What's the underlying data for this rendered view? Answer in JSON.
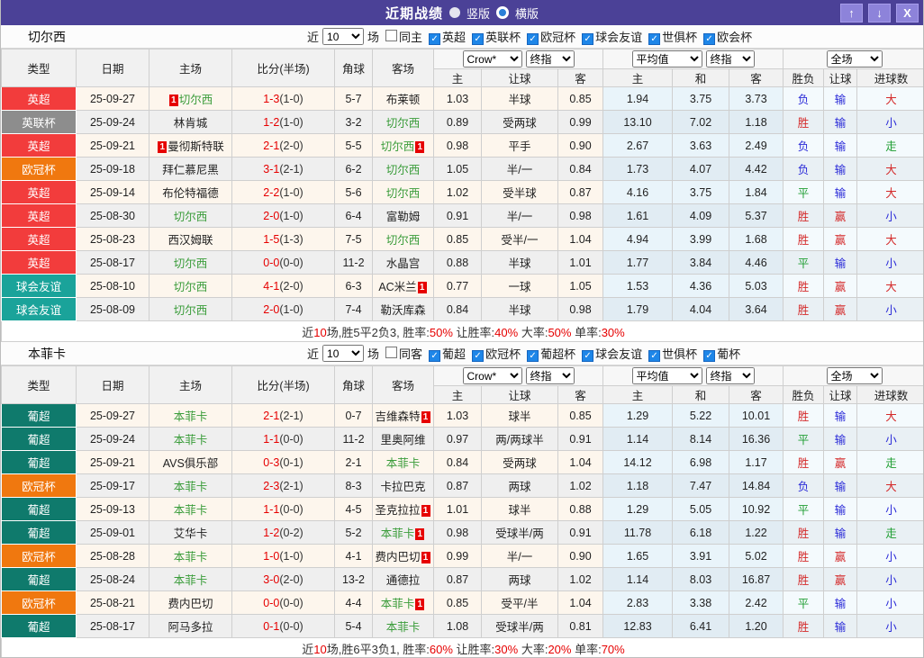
{
  "titlebar": {
    "title": "近期战绩",
    "radio_vertical": "竖版",
    "radio_horizontal": "横版",
    "buttons": {
      "up": "↑",
      "down": "↓",
      "close": "X"
    },
    "bg_color": "#4b4197",
    "button_color": "#8d83da"
  },
  "filter": {
    "prefix": "近",
    "count": "10",
    "suffix": "场"
  },
  "table_header": {
    "static_cols": [
      "类型",
      "日期",
      "主场",
      "比分(半场)",
      "角球",
      "客场"
    ],
    "select_groups": [
      [
        "Crow*",
        "终指"
      ],
      [
        "平均值",
        "终指"
      ],
      [
        "全场"
      ]
    ],
    "sub_cols": [
      "主",
      "让球",
      "客",
      "主",
      "和",
      "客",
      "胜负",
      "让球",
      "进球数"
    ]
  },
  "league_colors": {
    "英超": "#f23c3c",
    "英联杯": "#8d8d8d",
    "欧冠杯": "#f0780f",
    "球会友谊": "#1aa39a",
    "葡超": "#0f7a6c"
  },
  "result_colors": {
    "red": "#d42a2a",
    "blue": "#2b2bd8",
    "green": "#1f9e32"
  },
  "sections": [
    {
      "team": "切尔西",
      "same_side_label": "同主",
      "leagues": [
        "英超",
        "英联杯",
        "欧冠杯",
        "球会友谊",
        "世俱杯",
        "欧会杯"
      ],
      "rows": [
        {
          "league": "英超",
          "date": "25-09-27",
          "home": {
            "badge_before": "1",
            "name": "切尔西",
            "focus": true
          },
          "score": "1-3",
          "half": "(1-0)",
          "corners": "5-7",
          "away": {
            "name": "布莱顿"
          },
          "crow": [
            "1.03",
            "半球",
            "0.85"
          ],
          "avg": [
            "1.94",
            "3.75",
            "3.73"
          ],
          "full": [
            "负",
            "输",
            "大"
          ]
        },
        {
          "league": "英联杯",
          "date": "25-09-24",
          "home": {
            "name": "林肯城"
          },
          "score": "1-2",
          "half": "(1-0)",
          "corners": "3-2",
          "away": {
            "name": "切尔西",
            "focus": true
          },
          "crow": [
            "0.89",
            "受两球",
            "0.99"
          ],
          "avg": [
            "13.10",
            "7.02",
            "1.18"
          ],
          "full": [
            "胜",
            "输",
            "小"
          ]
        },
        {
          "league": "英超",
          "date": "25-09-21",
          "home": {
            "badge_before": "1",
            "name": "曼彻斯特联"
          },
          "score": "2-1",
          "half": "(2-0)",
          "corners": "5-5",
          "away": {
            "name": "切尔西",
            "focus": true,
            "badge_after": "1"
          },
          "crow": [
            "0.98",
            "平手",
            "0.90"
          ],
          "avg": [
            "2.67",
            "3.63",
            "2.49"
          ],
          "full": [
            "负",
            "输",
            "走"
          ]
        },
        {
          "league": "欧冠杯",
          "date": "25-09-18",
          "home": {
            "name": "拜仁慕尼黑"
          },
          "score": "3-1",
          "half": "(2-1)",
          "corners": "6-2",
          "away": {
            "name": "切尔西",
            "focus": true
          },
          "crow": [
            "1.05",
            "半/一",
            "0.84"
          ],
          "avg": [
            "1.73",
            "4.07",
            "4.42"
          ],
          "full": [
            "负",
            "输",
            "大"
          ]
        },
        {
          "league": "英超",
          "date": "25-09-14",
          "home": {
            "name": "布伦特福德"
          },
          "score": "2-2",
          "half": "(1-0)",
          "corners": "5-6",
          "away": {
            "name": "切尔西",
            "focus": true
          },
          "crow": [
            "1.02",
            "受半球",
            "0.87"
          ],
          "avg": [
            "4.16",
            "3.75",
            "1.84"
          ],
          "full": [
            "平",
            "输",
            "大"
          ]
        },
        {
          "league": "英超",
          "date": "25-08-30",
          "home": {
            "name": "切尔西",
            "focus": true
          },
          "score": "2-0",
          "half": "(1-0)",
          "corners": "6-4",
          "away": {
            "name": "富勒姆"
          },
          "crow": [
            "0.91",
            "半/一",
            "0.98"
          ],
          "avg": [
            "1.61",
            "4.09",
            "5.37"
          ],
          "full": [
            "胜",
            "赢",
            "小"
          ]
        },
        {
          "league": "英超",
          "date": "25-08-23",
          "home": {
            "name": "西汉姆联"
          },
          "score": "1-5",
          "half": "(1-3)",
          "corners": "7-5",
          "away": {
            "name": "切尔西",
            "focus": true
          },
          "crow": [
            "0.85",
            "受半/一",
            "1.04"
          ],
          "avg": [
            "4.94",
            "3.99",
            "1.68"
          ],
          "full": [
            "胜",
            "赢",
            "大"
          ]
        },
        {
          "league": "英超",
          "date": "25-08-17",
          "home": {
            "name": "切尔西",
            "focus": true
          },
          "score": "0-0",
          "half": "(0-0)",
          "corners": "11-2",
          "away": {
            "name": "水晶宫"
          },
          "crow": [
            "0.88",
            "半球",
            "1.01"
          ],
          "avg": [
            "1.77",
            "3.84",
            "4.46"
          ],
          "full": [
            "平",
            "输",
            "小"
          ]
        },
        {
          "league": "球会友谊",
          "date": "25-08-10",
          "home": {
            "name": "切尔西",
            "focus": true
          },
          "score": "4-1",
          "half": "(2-0)",
          "corners": "6-3",
          "away": {
            "name": "AC米兰",
            "badge_after": "1"
          },
          "crow": [
            "0.77",
            "一球",
            "1.05"
          ],
          "avg": [
            "1.53",
            "4.36",
            "5.03"
          ],
          "full": [
            "胜",
            "赢",
            "大"
          ]
        },
        {
          "league": "球会友谊",
          "date": "25-08-09",
          "home": {
            "name": "切尔西",
            "focus": true
          },
          "score": "2-0",
          "half": "(1-0)",
          "corners": "7-4",
          "away": {
            "name": "勒沃库森"
          },
          "crow": [
            "0.84",
            "半球",
            "0.98"
          ],
          "avg": [
            "1.79",
            "4.04",
            "3.64"
          ],
          "full": [
            "胜",
            "赢",
            "小"
          ]
        }
      ],
      "summary": [
        [
          "近",
          false
        ],
        [
          "10",
          true
        ],
        [
          "场,胜5平2负3, 胜率:",
          false
        ],
        [
          "50%",
          true
        ],
        [
          " 让胜率:",
          false
        ],
        [
          "40%",
          true
        ],
        [
          " 大率:",
          false
        ],
        [
          "50%",
          true
        ],
        [
          " 单率:",
          false
        ],
        [
          "30%",
          true
        ]
      ]
    },
    {
      "team": "本菲卡",
      "same_side_label": "同客",
      "leagues": [
        "葡超",
        "欧冠杯",
        "葡超杯",
        "球会友谊",
        "世俱杯",
        "葡杯"
      ],
      "rows": [
        {
          "league": "葡超",
          "date": "25-09-27",
          "home": {
            "name": "本菲卡",
            "focus": true
          },
          "score": "2-1",
          "half": "(2-1)",
          "corners": "0-7",
          "away": {
            "name": "吉维森特",
            "badge_after": "1"
          },
          "crow": [
            "1.03",
            "球半",
            "0.85"
          ],
          "avg": [
            "1.29",
            "5.22",
            "10.01"
          ],
          "full": [
            "胜",
            "输",
            "大"
          ]
        },
        {
          "league": "葡超",
          "date": "25-09-24",
          "home": {
            "name": "本菲卡",
            "focus": true
          },
          "score": "1-1",
          "half": "(0-0)",
          "corners": "11-2",
          "away": {
            "name": "里奥阿维"
          },
          "crow": [
            "0.97",
            "两/两球半",
            "0.91"
          ],
          "avg": [
            "1.14",
            "8.14",
            "16.36"
          ],
          "full": [
            "平",
            "输",
            "小"
          ]
        },
        {
          "league": "葡超",
          "date": "25-09-21",
          "home": {
            "name": "AVS俱乐部"
          },
          "score": "0-3",
          "half": "(0-1)",
          "corners": "2-1",
          "away": {
            "name": "本菲卡",
            "focus": true
          },
          "crow": [
            "0.84",
            "受两球",
            "1.04"
          ],
          "avg": [
            "14.12",
            "6.98",
            "1.17"
          ],
          "full": [
            "胜",
            "赢",
            "走"
          ]
        },
        {
          "league": "欧冠杯",
          "date": "25-09-17",
          "home": {
            "name": "本菲卡",
            "focus": true
          },
          "score": "2-3",
          "half": "(2-1)",
          "corners": "8-3",
          "away": {
            "name": "卡拉巴克"
          },
          "crow": [
            "0.87",
            "两球",
            "1.02"
          ],
          "avg": [
            "1.18",
            "7.47",
            "14.84"
          ],
          "full": [
            "负",
            "输",
            "大"
          ]
        },
        {
          "league": "葡超",
          "date": "25-09-13",
          "home": {
            "name": "本菲卡",
            "focus": true
          },
          "score": "1-1",
          "half": "(0-0)",
          "corners": "4-5",
          "away": {
            "name": "圣克拉拉",
            "badge_after": "1"
          },
          "crow": [
            "1.01",
            "球半",
            "0.88"
          ],
          "avg": [
            "1.29",
            "5.05",
            "10.92"
          ],
          "full": [
            "平",
            "输",
            "小"
          ]
        },
        {
          "league": "葡超",
          "date": "25-09-01",
          "home": {
            "name": "艾华卡"
          },
          "score": "1-2",
          "half": "(0-2)",
          "corners": "5-2",
          "away": {
            "name": "本菲卡",
            "focus": true,
            "badge_after": "1"
          },
          "crow": [
            "0.98",
            "受球半/两",
            "0.91"
          ],
          "avg": [
            "11.78",
            "6.18",
            "1.22"
          ],
          "full": [
            "胜",
            "输",
            "走"
          ]
        },
        {
          "league": "欧冠杯",
          "date": "25-08-28",
          "home": {
            "name": "本菲卡",
            "focus": true
          },
          "score": "1-0",
          "half": "(1-0)",
          "corners": "4-1",
          "away": {
            "name": "费内巴切",
            "badge_after": "1"
          },
          "crow": [
            "0.99",
            "半/一",
            "0.90"
          ],
          "avg": [
            "1.65",
            "3.91",
            "5.02"
          ],
          "full": [
            "胜",
            "赢",
            "小"
          ]
        },
        {
          "league": "葡超",
          "date": "25-08-24",
          "home": {
            "name": "本菲卡",
            "focus": true
          },
          "score": "3-0",
          "half": "(2-0)",
          "corners": "13-2",
          "away": {
            "name": "通德拉"
          },
          "crow": [
            "0.87",
            "两球",
            "1.02"
          ],
          "avg": [
            "1.14",
            "8.03",
            "16.87"
          ],
          "full": [
            "胜",
            "赢",
            "小"
          ]
        },
        {
          "league": "欧冠杯",
          "date": "25-08-21",
          "home": {
            "name": "费内巴切"
          },
          "score": "0-0",
          "half": "(0-0)",
          "corners": "4-4",
          "away": {
            "name": "本菲卡",
            "focus": true,
            "badge_after": "1"
          },
          "crow": [
            "0.85",
            "受平/半",
            "1.04"
          ],
          "avg": [
            "2.83",
            "3.38",
            "2.42"
          ],
          "full": [
            "平",
            "输",
            "小"
          ]
        },
        {
          "league": "葡超",
          "date": "25-08-17",
          "home": {
            "name": "阿马多拉"
          },
          "score": "0-1",
          "half": "(0-0)",
          "corners": "5-4",
          "away": {
            "name": "本菲卡",
            "focus": true
          },
          "crow": [
            "1.08",
            "受球半/两",
            "0.81"
          ],
          "avg": [
            "12.83",
            "6.41",
            "1.20"
          ],
          "full": [
            "胜",
            "输",
            "小"
          ]
        }
      ],
      "summary": [
        [
          "近",
          false
        ],
        [
          "10",
          true
        ],
        [
          "场,胜6平3负1, 胜率:",
          false
        ],
        [
          "60%",
          true
        ],
        [
          " 让胜率:",
          false
        ],
        [
          "30%",
          true
        ],
        [
          " 大率:",
          false
        ],
        [
          "20%",
          true
        ],
        [
          " 单率:",
          false
        ],
        [
          "70%",
          true
        ]
      ]
    }
  ]
}
